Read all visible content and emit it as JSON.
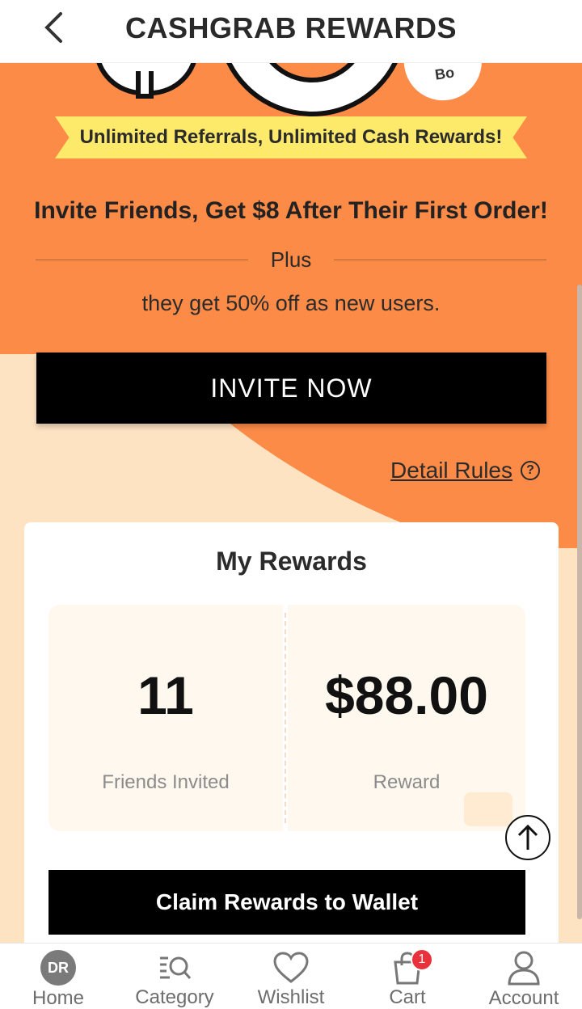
{
  "header": {
    "title": "CASHGRAB REWARDS"
  },
  "hero": {
    "badge_text": "Bo",
    "ribbon_text": "Unlimited Referrals, Unlimited Cash Rewards!",
    "headline": "Invite Friends, Get $8 After Their First Order!",
    "plus_text": "Plus",
    "subtext": "they get 50% off as new users.",
    "invite_button": "INVITE NOW",
    "detail_rules": "Detail Rules"
  },
  "rewards": {
    "title": "My Rewards",
    "friends_invited_value": "11",
    "friends_invited_label": "Friends Invited",
    "reward_value": "$88.00",
    "reward_label": "Reward",
    "claim_button": "Claim Rewards to Wallet"
  },
  "nav": {
    "items": [
      {
        "label": "Home",
        "icon": "home-logo-icon",
        "logo_text": "DR"
      },
      {
        "label": "Category",
        "icon": "category-icon"
      },
      {
        "label": "Wishlist",
        "icon": "heart-icon"
      },
      {
        "label": "Cart",
        "icon": "cart-icon",
        "badge": "1"
      },
      {
        "label": "Account",
        "icon": "account-icon"
      }
    ]
  },
  "colors": {
    "accent_orange": "#fc8b48",
    "cream": "#fde3c2",
    "ribbon_yellow": "#fde96a",
    "badge_red": "#e8313a"
  }
}
